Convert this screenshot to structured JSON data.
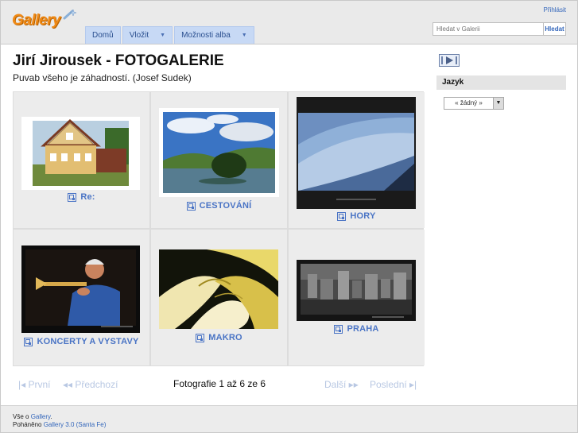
{
  "header": {
    "logo_text": "Gallery",
    "nav": [
      {
        "label": "Domů",
        "has_menu": false
      },
      {
        "label": "Vložit",
        "has_menu": true
      },
      {
        "label": "Možnosti alba",
        "has_menu": true
      }
    ],
    "login_label": "Přihlásit",
    "search": {
      "placeholder": "Hledat v Galerii",
      "button_label": "Hledat"
    }
  },
  "page": {
    "title": "Jirí Jirousek - FOTOGALERIE",
    "subtitle": "Puvab všeho je záhadností. (Josef Sudek)"
  },
  "albums": [
    {
      "title": "Re:"
    },
    {
      "title": "CESTOVÁNÍ"
    },
    {
      "title": "HORY"
    },
    {
      "title": "KONCERTY A VYSTAVY"
    },
    {
      "title": "MAKRO"
    },
    {
      "title": "PRAHA"
    }
  ],
  "pager": {
    "first": "|◂ První",
    "prev": "◂◂ Předchozí",
    "status": "Fotografie 1 až 6 ze 6",
    "next": "Další ▸▸",
    "last": "Poslední ▸|"
  },
  "sidebar": {
    "slideshow_icon": "slideshow-icon",
    "language_heading": "Jazyk",
    "language_value": "« žádný »"
  },
  "footer": {
    "about_prefix": "Vše o ",
    "about_link": "Gallery",
    "about_suffix": ".",
    "powered_prefix": "Poháněno ",
    "powered_link": "Gallery 3.0 (Santa Fe)"
  },
  "colors": {
    "accent": "#4a74c5",
    "nav_tab": "#c7d9f5",
    "logo": "#f08a16"
  }
}
